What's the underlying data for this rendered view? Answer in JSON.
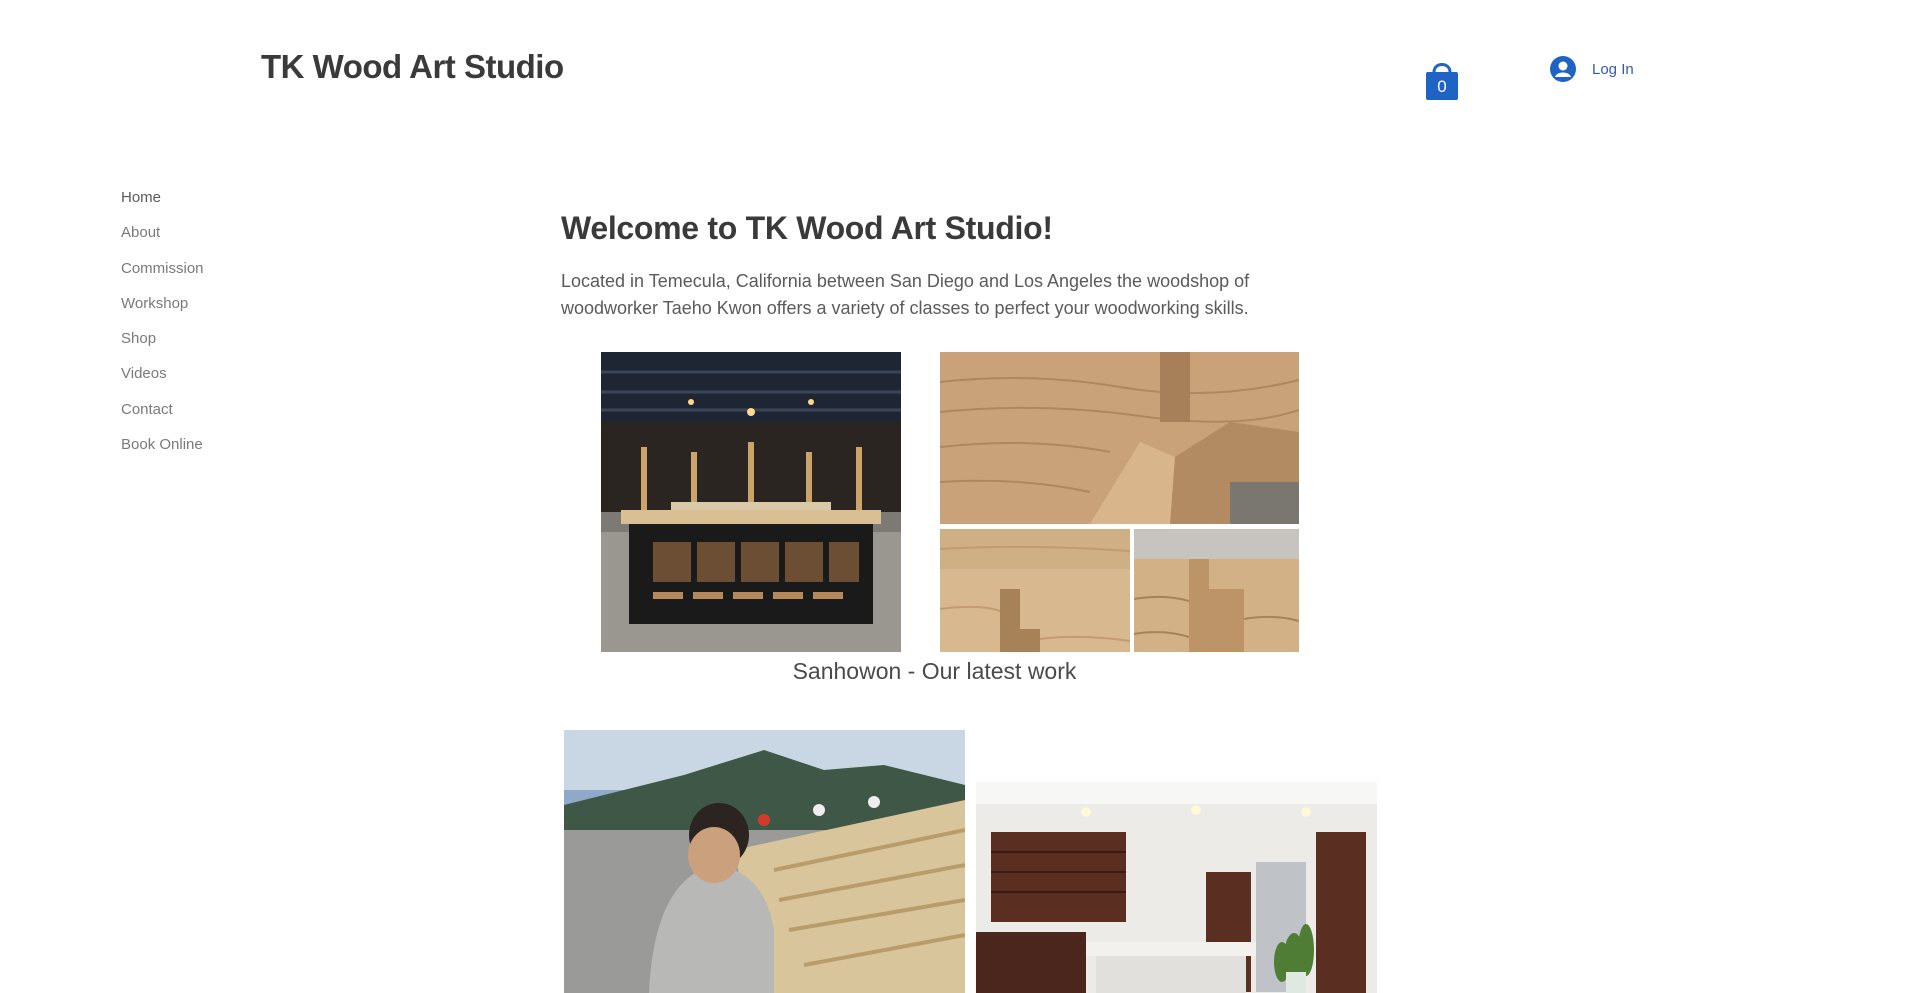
{
  "header": {
    "site_title": "TK Wood Art Studio",
    "cart_count": "0",
    "login_label": "Log In"
  },
  "nav": {
    "items": [
      {
        "label": "Home"
      },
      {
        "label": "About"
      },
      {
        "label": "Commission"
      },
      {
        "label": "Workshop"
      },
      {
        "label": "Shop"
      },
      {
        "label": "Videos"
      },
      {
        "label": "Contact"
      },
      {
        "label": "Book Online"
      }
    ]
  },
  "main": {
    "heading": "Welcome to TK Wood Art Studio!",
    "intro": "Located in Temecula, California between San Diego and Los Angeles the woodshop of woodworker Taeho Kwon offers a variety of classes to perfect your woodworking skills.",
    "caption": "Sanhowon - Our latest work"
  },
  "colors": {
    "accent": "#1f63c6",
    "text": "#3a3a3a"
  }
}
